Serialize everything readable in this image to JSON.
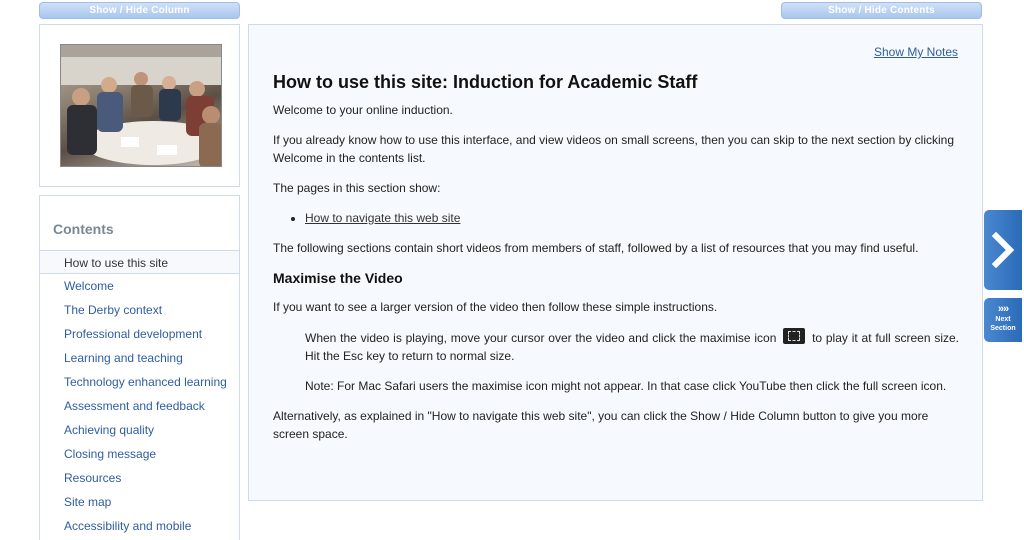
{
  "header": {
    "show_hide_column": "Show / Hide Column",
    "show_hide_contents": "Show / Hide Contents"
  },
  "sidebar": {
    "contents_title": "Contents",
    "items": [
      {
        "label": "How to use this site",
        "active": true
      },
      {
        "label": "Welcome"
      },
      {
        "label": "The Derby context"
      },
      {
        "label": "Professional development"
      },
      {
        "label": "Learning and teaching"
      },
      {
        "label": "Technology enhanced learning"
      },
      {
        "label": "Assessment and feedback"
      },
      {
        "label": "Achieving quality"
      },
      {
        "label": "Closing message"
      },
      {
        "label": "Resources"
      },
      {
        "label": "Site map"
      },
      {
        "label": "Accessibility and mobile"
      }
    ]
  },
  "main": {
    "notes_link": "Show My Notes",
    "title": "How to use this site: Induction for Academic Staff",
    "welcome": "Welcome to your online induction.",
    "intro": "If you already know how to use this interface, and view videos on small screens, then you can skip to the next section by clicking Welcome in the contents list.",
    "pages_show": "The pages in this section show:",
    "nav_link": "How to navigate this web site",
    "following": "The following sections contain short videos from members of staff, followed by a list of resources that you may find useful.",
    "section_heading": "Maximise the Video",
    "larger": "If you want to see a larger version of the video then follow these simple instructions.",
    "instr_part1": "When the video is playing, move your cursor over the video and click the maximise icon",
    "instr_part2": "to play it at full screen size. Hit the Esc key to return to normal size.",
    "note": "Note: For Mac Safari users the maximise icon might not appear. In that case click YouTube then click the full screen icon.",
    "alternatively": "Alternatively, as explained in \"How to navigate this web site\", you can click the Show / Hide Column button to give you more screen space."
  },
  "nav": {
    "next_chevrons": "»»",
    "next_label_line1": "Next",
    "next_label_line2": "Section"
  },
  "colors": {
    "accent": "#2b6ab8",
    "link": "#2f5da0",
    "panel_background": "#f6f9fd"
  }
}
